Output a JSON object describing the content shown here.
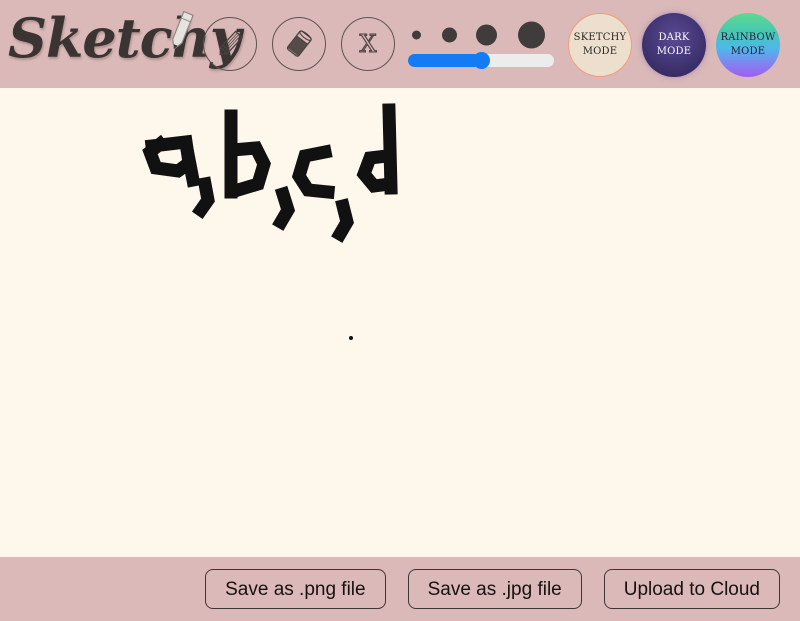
{
  "app": {
    "title": "Sketchy",
    "logo_icon": "pencil-icon"
  },
  "toolbar": {
    "tools": [
      {
        "name": "pencil",
        "icon": "pencil-icon",
        "label": "Pencil",
        "selected": true
      },
      {
        "name": "eraser",
        "icon": "eraser-icon",
        "label": "Eraser",
        "selected": false
      },
      {
        "name": "clear",
        "icon": "x-icon",
        "label": "X",
        "selected": false
      }
    ],
    "brush_size": {
      "label": "Brush size",
      "value": 50,
      "min": 0,
      "max": 100,
      "dot_sizes": [
        9,
        15,
        21,
        27
      ],
      "fill_color": "#137bf3",
      "track_color": "#ececec"
    },
    "modes": [
      {
        "name": "sketchy",
        "line1": "SKETCHY",
        "line2": "MODE",
        "accent": "#ecdfcd",
        "border": "#ef9d7d",
        "text_color": "#2b2724"
      },
      {
        "name": "dark",
        "line1": "DARK",
        "line2": "MODE",
        "accent": "#453879",
        "text_color": "#ffffff"
      },
      {
        "name": "rainbow",
        "line1": "RAINBOW",
        "line2": "MODE",
        "accent": "#4fb8e8",
        "text_color": "#241f2e"
      }
    ]
  },
  "canvas": {
    "background": "#fdf7ec",
    "stroke_color": "#111111",
    "drawing_text": "a, b, c, d"
  },
  "footer": {
    "buttons": [
      {
        "name": "save-png",
        "label": "Save as .png file"
      },
      {
        "name": "save-jpg",
        "label": "Save as .jpg file"
      },
      {
        "name": "upload-cloud",
        "label": "Upload to Cloud"
      }
    ]
  },
  "colors": {
    "bar": "#dbb9b8",
    "canvas": "#fdf7ec",
    "ink": "#111111",
    "slider": "#137bf3"
  }
}
